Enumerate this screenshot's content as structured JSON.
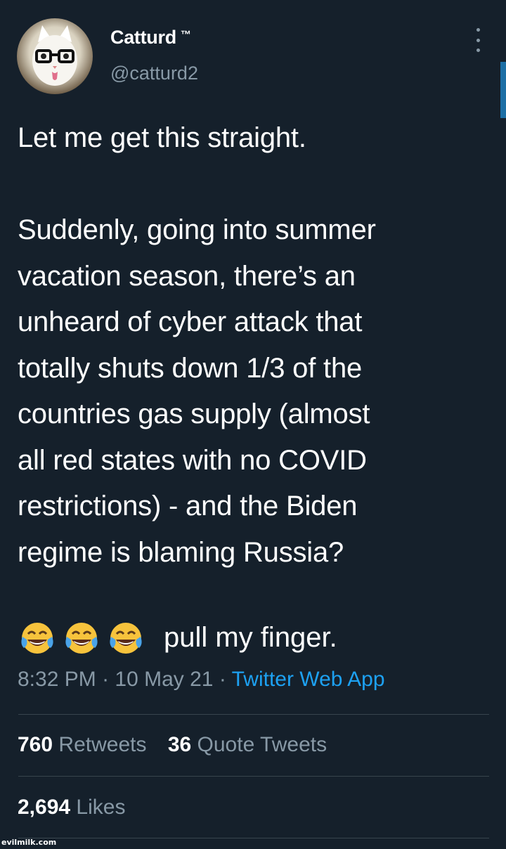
{
  "user": {
    "display_name": "Catturd",
    "trademark": "™",
    "handle": "@catturd2",
    "avatar_icon": "cat-with-glasses-avatar"
  },
  "tweet": {
    "lines": [
      "Let me get this straight.",
      "",
      "Suddenly, going into summer",
      "vacation season, there’s an",
      "unheard of cyber attack that",
      "totally shuts down 1/3 of the",
      "countries gas supply (almost",
      "all red states with no COVID",
      "restrictions) - and the Biden",
      "regime is blaming Russia?"
    ],
    "emojis": [
      "face-with-tears-of-joy",
      "face-with-tears-of-joy",
      "face-with-tears-of-joy"
    ],
    "emoji_text": "pull my finger."
  },
  "meta": {
    "time": "8:32 PM",
    "separator": " · ",
    "date": "10 May 21",
    "source": "Twitter Web App"
  },
  "stats": {
    "retweets_count": "760",
    "retweets_label": "Retweets",
    "quotes_count": "36",
    "quotes_label": "Quote Tweets",
    "likes_count": "2,694",
    "likes_label": "Likes"
  },
  "colors": {
    "background": "#15202b",
    "text": "#ffffff",
    "secondary": "#8899a6",
    "link": "#1da1f2",
    "divider": "#38444d"
  },
  "watermark": "evilmilk.com"
}
